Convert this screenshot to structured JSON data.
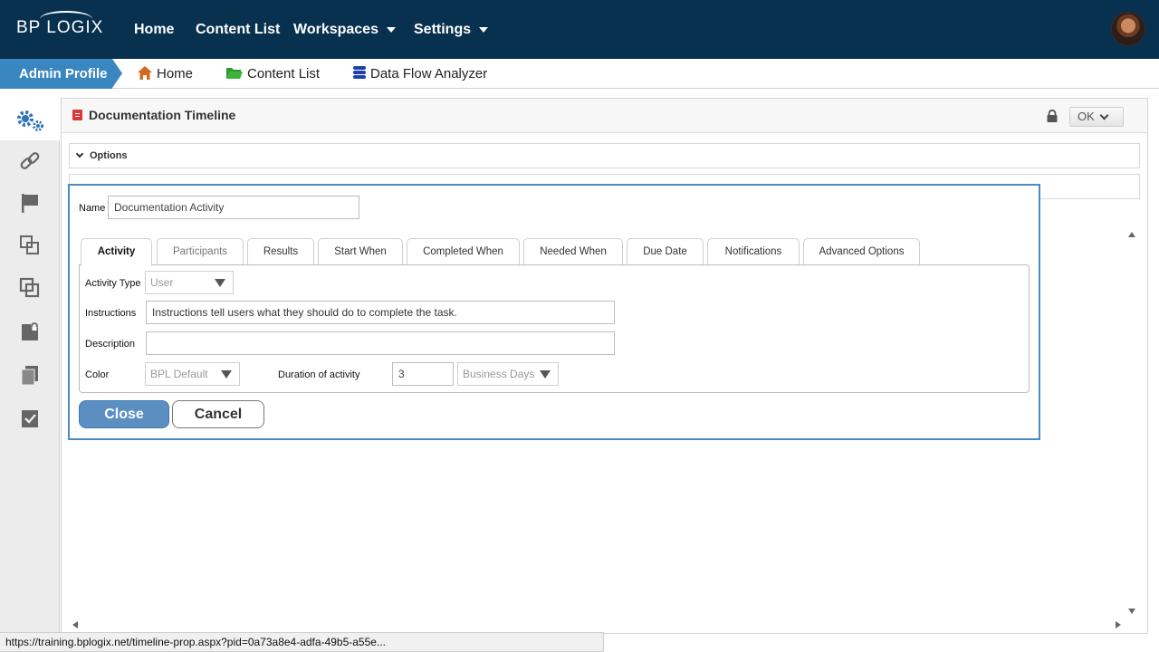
{
  "topnav": {
    "logo": "BP LOGIX",
    "items": [
      {
        "label": "Home",
        "dropdown": false
      },
      {
        "label": "Content List",
        "dropdown": false
      },
      {
        "label": "Workspaces",
        "dropdown": true
      },
      {
        "label": "Settings",
        "dropdown": true
      }
    ]
  },
  "breadcrumbs": {
    "active": "Admin Profile",
    "items": [
      {
        "label": "Home",
        "icon": "home-icon"
      },
      {
        "label": "Content List",
        "icon": "folder-icon"
      },
      {
        "label": "Data Flow Analyzer",
        "icon": "database-icon"
      }
    ]
  },
  "sidebar": {
    "icons": [
      "gears-icon",
      "link-icon",
      "flag-icon",
      "copy-icon",
      "overlap-icon",
      "locked-file-icon",
      "documents-icon",
      "checklist-icon"
    ]
  },
  "panel": {
    "title": "Documentation Timeline",
    "ok_label": "OK",
    "accordions": [
      "Options",
      ""
    ]
  },
  "dialog": {
    "name_label": "Name",
    "name_value": "Documentation Activity",
    "tabs": [
      {
        "label": "Activity",
        "active": true
      },
      {
        "label": "Participants",
        "disabled": true
      },
      {
        "label": "Results"
      },
      {
        "label": "Start When"
      },
      {
        "label": "Completed When"
      },
      {
        "label": "Needed When"
      },
      {
        "label": "Due Date"
      },
      {
        "label": "Notifications"
      },
      {
        "label": "Advanced Options"
      }
    ],
    "activity_type_label": "Activity Type",
    "activity_type_value": "User",
    "instructions_label": "Instructions",
    "instructions_value": "Instructions tell users what they should do to complete the task.",
    "description_label": "Description",
    "description_value": "",
    "color_label": "Color",
    "color_value": "BPL Default",
    "duration_label": "Duration of activity",
    "duration_value": "3",
    "duration_unit": "Business Days",
    "close_label": "Close",
    "cancel_label": "Cancel"
  },
  "status_url": "https://training.bplogix.net/timeline-prop.aspx?pid=0a73a8e4-adfa-49b5-a55e...",
  "colors": {
    "topbar": "#08304f",
    "accent": "#3a86c0",
    "dialog_border": "#4c8bc0",
    "close_button": "#5b8fc1"
  }
}
